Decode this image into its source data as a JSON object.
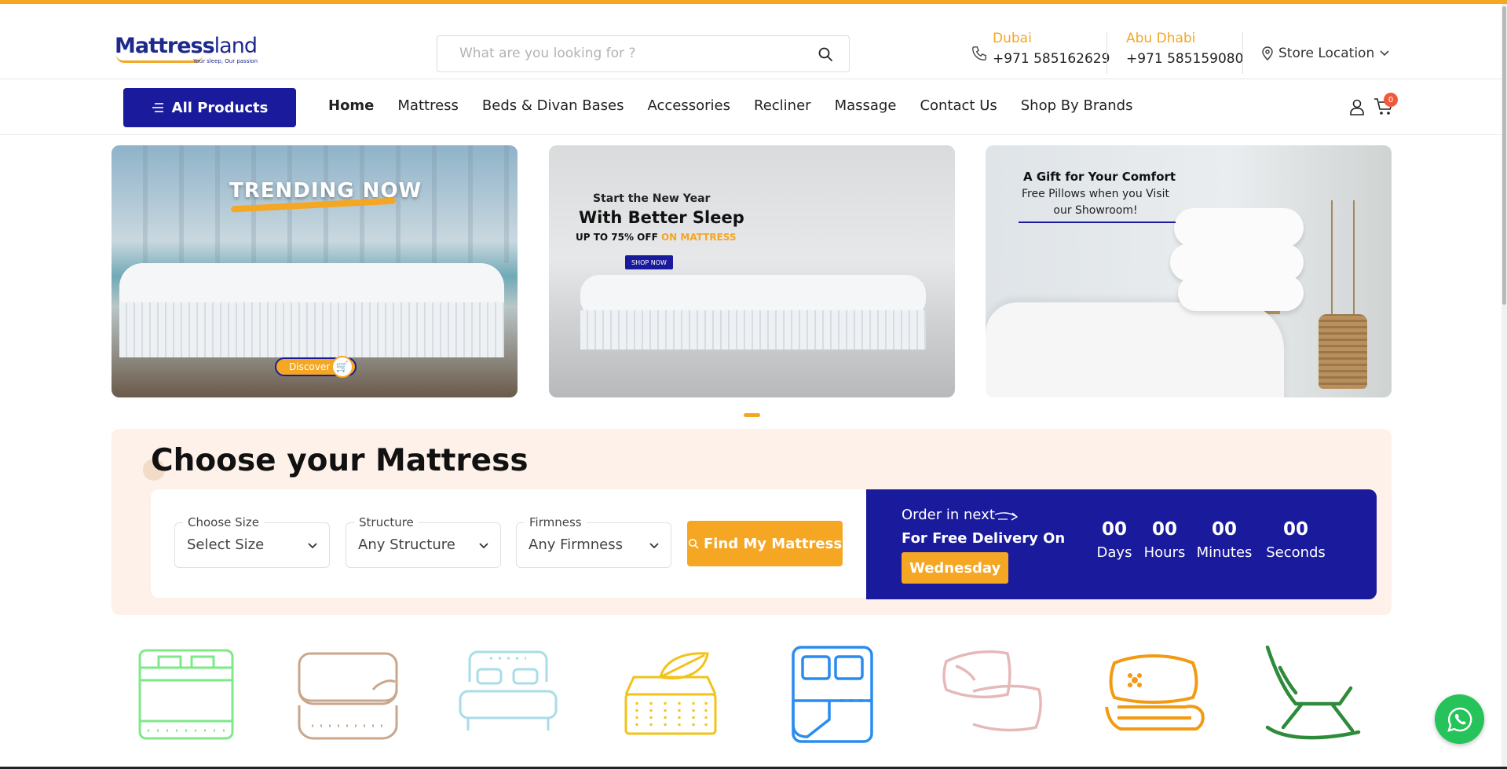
{
  "header": {
    "brand_main": "Mattress",
    "brand_suffix": "land",
    "tagline": "Your sleep, Our passion",
    "search_placeholder": "What are you looking for ?",
    "contacts": [
      {
        "city": "Dubai",
        "phone": "+971 585162629"
      },
      {
        "city": "Abu Dhabi",
        "phone": "+971 585159080"
      }
    ],
    "store_location": "Store Location"
  },
  "nav": {
    "all_products": "All Products",
    "items": [
      "Home",
      "Mattress",
      "Beds & Divan Bases",
      "Accessories",
      "Recliner",
      "Massage",
      "Contact Us",
      "Shop By Brands"
    ],
    "active": "Home",
    "cart_count": "0"
  },
  "banners": [
    {
      "title": "TRENDING NOW",
      "button": "Discover"
    },
    {
      "line1": "Start the New Year",
      "line2": "With Better Sleep",
      "line3_a": "UP TO 75% OFF",
      "line3_b": "ON MATTRESS",
      "button": "SHOP NOW"
    },
    {
      "line1": "A Gift for Your Comfort",
      "line2": "Free Pillows when you Visit our Showroom!"
    }
  ],
  "choose": {
    "title": "Choose your Mattress",
    "filters": [
      {
        "label": "Choose Size",
        "value": "Select Size"
      },
      {
        "label": "Structure",
        "value": "Any Structure"
      },
      {
        "label": "Firmness",
        "value": "Any Firmness"
      }
    ],
    "find_button": "Find My Mattress",
    "order": {
      "line1": "Order in next",
      "line2": "For Free Delivery On",
      "day": "Wednesday",
      "countdown": [
        {
          "value": "00",
          "unit": "Days"
        },
        {
          "value": "00",
          "unit": "Hours"
        },
        {
          "value": "00",
          "unit": "Minutes"
        },
        {
          "value": "00",
          "unit": "Seconds"
        }
      ]
    }
  },
  "categories": [
    {
      "icon": "bed-frame-icon",
      "color": "#7ee88a"
    },
    {
      "icon": "mattress-topper-icon",
      "color": "#c9a68c"
    },
    {
      "icon": "bed-icon",
      "color": "#a8dde8"
    },
    {
      "icon": "natural-mattress-icon",
      "color": "#f2c318"
    },
    {
      "icon": "bed-sheet-icon",
      "color": "#2a8cf0"
    },
    {
      "icon": "pillows-icon",
      "color": "#e6b9b9"
    },
    {
      "icon": "cushion-blanket-icon",
      "color": "#f29a12"
    },
    {
      "icon": "rocking-chair-icon",
      "color": "#2e8b3a"
    }
  ],
  "colors": {
    "accent": "#f5a623",
    "brand_blue": "#1a1a9c",
    "panel_bg": "#fdf1ea"
  }
}
